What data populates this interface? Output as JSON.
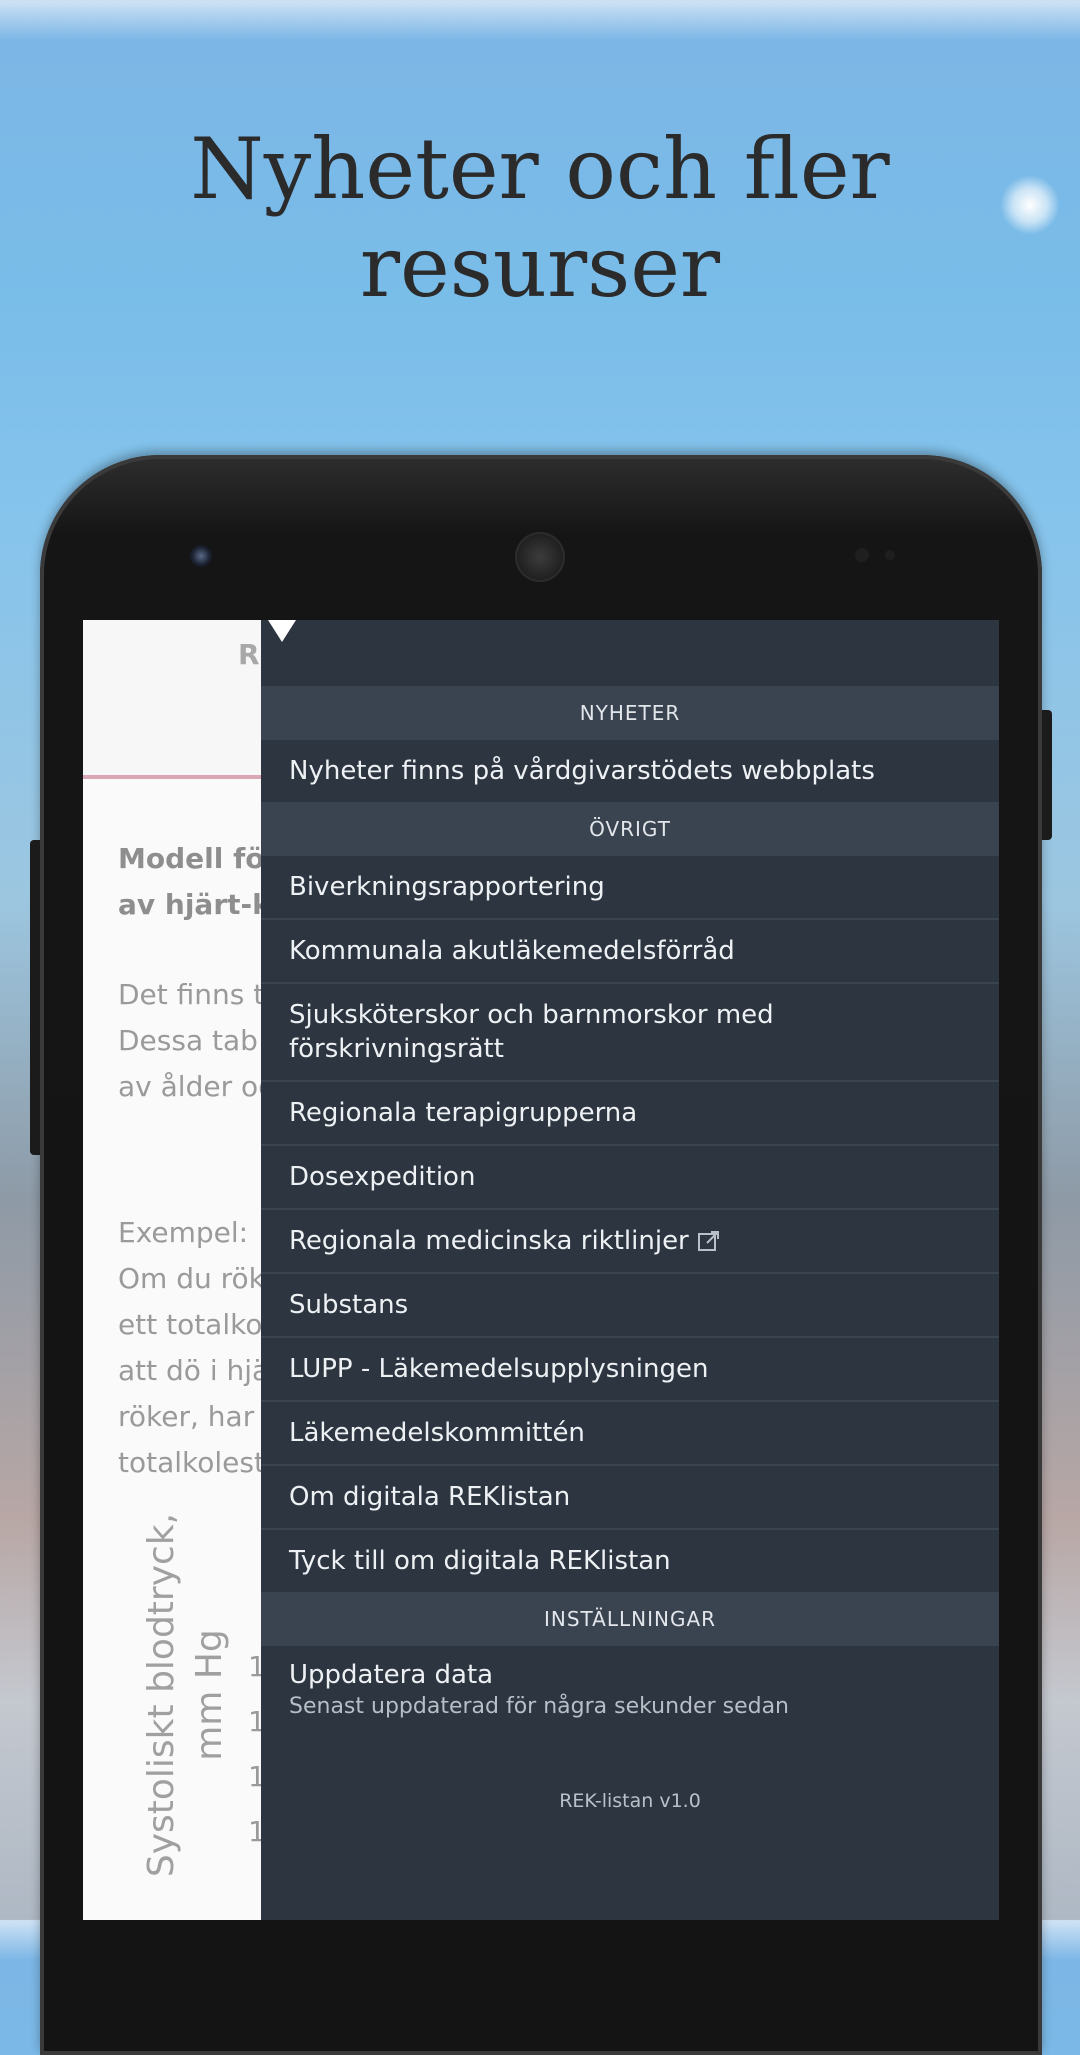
{
  "headline": "Nyheter och fler resurser",
  "background_app": {
    "tab_letter": "R",
    "heading_line1": "Modell för",
    "heading_line2": "av hjärt-ka",
    "para1": [
      "Det finns t",
      "Dessa tab",
      "av ålder oc"
    ],
    "example_label": "Exempel:",
    "para2": [
      "Om du rök",
      "ett totalkol",
      "att dö i hjä",
      "röker, har",
      "totalkolest"
    ],
    "axis_label_line1": "Systoliskt blodtryck,",
    "axis_label_line2": "mm Hg",
    "axis_ticks": [
      "1",
      "1",
      "1",
      "1"
    ]
  },
  "drawer": {
    "sections": [
      {
        "header": "NYHETER",
        "items": [
          "Nyheter finns på vårdgivarstödets webbplats"
        ]
      },
      {
        "header": "ÖVRIGT",
        "items": [
          "Biverkningsrapportering",
          "Kommunala akutläkemedelsförråd",
          "Sjuksköterskor och barnmorskor med förskrivningsrätt",
          "Regionala terapigrupperna",
          "Dosexpedition",
          "Regionala medicinska riktlinjer",
          "Substans",
          "LUPP - Läkemedelsupplysningen",
          "Läkemedelskommittén",
          "Om digitala REKlistan",
          "Tyck till om digitala REKlistan"
        ]
      },
      {
        "header": "INSTÄLLNINGAR",
        "update_title": "Uppdatera data",
        "update_subtitle": "Senast uppdaterad för några sekunder sedan"
      }
    ],
    "version": "REK-listan v1.0",
    "external_icon": "external-link-icon"
  }
}
